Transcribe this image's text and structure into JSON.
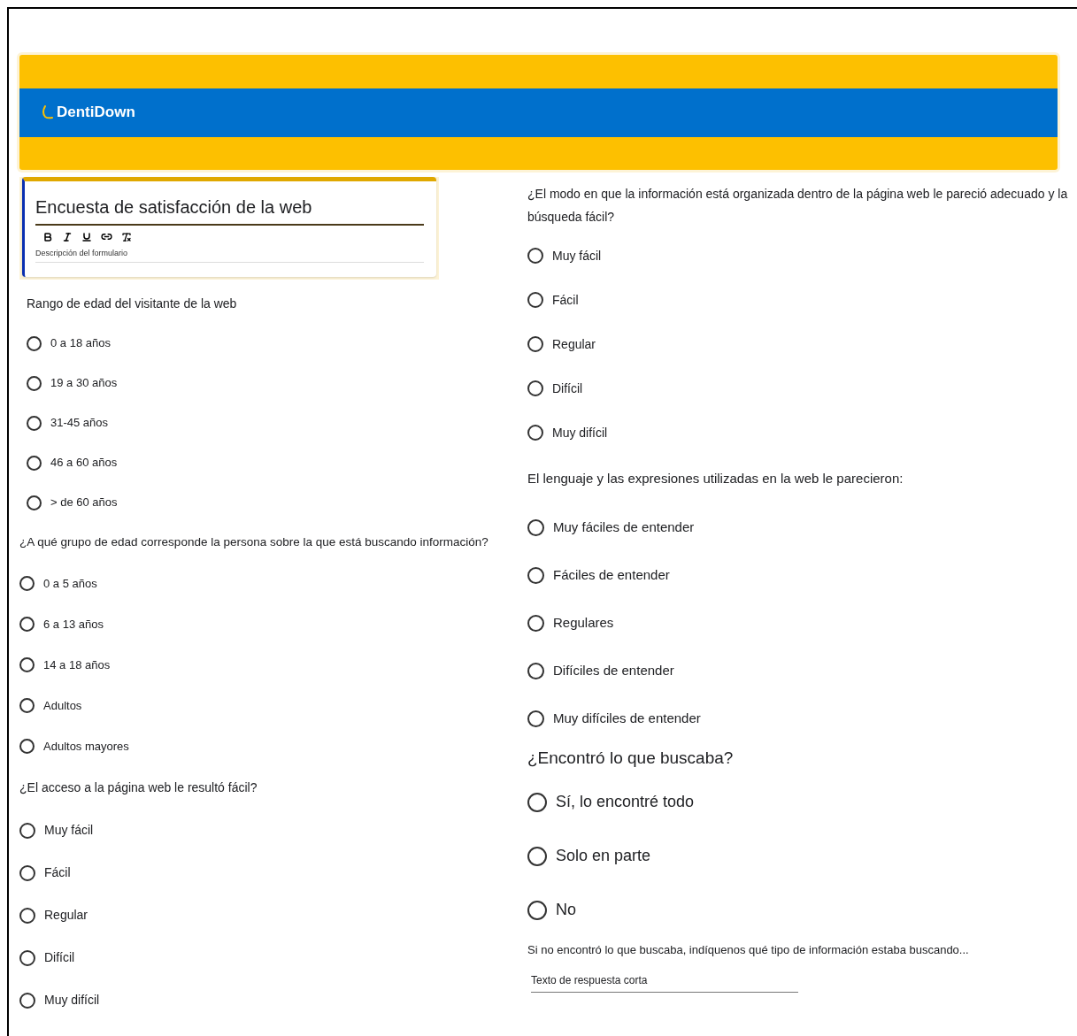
{
  "header": {
    "brand": "DentiDown"
  },
  "form_card": {
    "title": "Encuesta de satisfacción de la web",
    "description_placeholder": "Descripción del formulario"
  },
  "left_questions": [
    {
      "kind": "choice",
      "label": "Rango de edad del visitante de la web",
      "options": [
        {
          "label": "0 a 18 años",
          "selected": false
        },
        {
          "label": "19 a 30 años",
          "selected": false
        },
        {
          "label": "31-45 años",
          "selected": false
        },
        {
          "label": "46 a 60 años",
          "selected": false
        },
        {
          "label": "> de 60 años",
          "selected": false
        }
      ]
    },
    {
      "kind": "choice",
      "label": "¿A qué grupo de edad corresponde la persona sobre la que está buscando información?",
      "options": [
        {
          "label": "0 a 5 años",
          "selected": false
        },
        {
          "label": "6 a 13 años",
          "selected": false
        },
        {
          "label": "14 a 18 años",
          "selected": false
        },
        {
          "label": "Adultos",
          "selected": false
        },
        {
          "label": "Adultos mayores",
          "selected": false
        }
      ]
    },
    {
      "kind": "choice",
      "label": "¿El acceso a la página web le resultó fácil?",
      "options": [
        {
          "label": "Muy fácil",
          "selected": false
        },
        {
          "label": "Fácil",
          "selected": false
        },
        {
          "label": "Regular",
          "selected": false
        },
        {
          "label": "Difícil",
          "selected": false
        },
        {
          "label": "Muy difícil",
          "selected": false
        }
      ]
    }
  ],
  "right_questions": [
    {
      "kind": "choice",
      "label": "¿El modo en que la información está organizada dentro de la página web le pareció adecuado y la búsqueda fácil?",
      "options": [
        {
          "label": "Muy fácil",
          "selected": false
        },
        {
          "label": "Fácil",
          "selected": false
        },
        {
          "label": "Regular",
          "selected": false
        },
        {
          "label": "Difícil",
          "selected": false
        },
        {
          "label": "Muy difícil",
          "selected": false
        }
      ]
    },
    {
      "kind": "choice",
      "label": "El lenguaje y las expresiones utilizadas en la web le parecieron:",
      "options": [
        {
          "label": "Muy fáciles de entender",
          "selected": false
        },
        {
          "label": "Fáciles de entender",
          "selected": false
        },
        {
          "label": "Regulares",
          "selected": false
        },
        {
          "label": "Difíciles de entender",
          "selected": false
        },
        {
          "label": "Muy difíciles de entender",
          "selected": false
        }
      ]
    },
    {
      "kind": "choice",
      "label": "¿Encontró lo que buscaba?",
      "options": [
        {
          "label": "Sí, lo encontré todo",
          "selected": false
        },
        {
          "label": "Solo en parte",
          "selected": false
        },
        {
          "label": "No",
          "selected": false
        }
      ]
    },
    {
      "kind": "short_text",
      "label": "Si no encontró lo que buscaba, indíquenos qué tipo de información estaba buscando...",
      "placeholder": "Texto de respuesta corta"
    }
  ]
}
